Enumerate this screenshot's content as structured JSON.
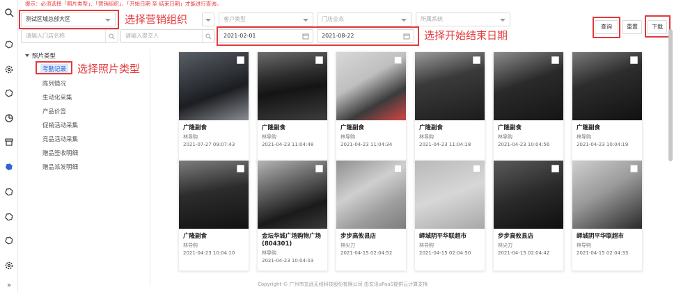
{
  "notice": "提示：必须选择「照片类型」、「营销组织」、「开始日期 至 结束日期」才能进行查询。",
  "filters": {
    "org_value": "测试区域总部大区",
    "channel_placeholder": "",
    "customer_type_placeholder": "客户类型",
    "store_type_placeholder": "门店业态",
    "system_placeholder": "所属系统",
    "store_search_placeholder": "请输入门店名称",
    "submitter_placeholder": "请输入提交人",
    "start_date": "2021-02-01",
    "end_date": "2021-08-22"
  },
  "buttons": {
    "query": "查询",
    "reset": "重置",
    "download": "下载"
  },
  "annotations": {
    "org": "选择营销组织",
    "date": "选择开始结束日期",
    "photo_type": "选择照片类型"
  },
  "tree": {
    "root": "照片类型",
    "items": [
      "考勤记录",
      "陈列情况",
      "生动化采集",
      "产品价签",
      "促销活动采集",
      "竞品活动采集",
      "赠品签收明细",
      "赠品派发明细"
    ]
  },
  "cards": [
    {
      "name": "广隆副食",
      "person": "林导购",
      "time": "2021-07-27 09:07:43"
    },
    {
      "name": "广隆副食",
      "person": "林导购",
      "time": "2021-04-23 11:04:48"
    },
    {
      "name": "广隆副食",
      "person": "林导购",
      "time": "2021-04-23 11:04:34"
    },
    {
      "name": "广隆副食",
      "person": "林导购",
      "time": "2021-04-23 11:04:18"
    },
    {
      "name": "广隆副食",
      "person": "林导购",
      "time": "2021-04-23 10:04:56"
    },
    {
      "name": "广隆副食",
      "person": "林导购",
      "time": "2021-04-23 10:04:19"
    },
    {
      "name": "广隆副食",
      "person": "林导购",
      "time": "2021-04-23 10:04:10"
    },
    {
      "name": "金坛华城广场购物广场(804301)",
      "person": "林导购",
      "time": "2021-04-23 10:04:03"
    },
    {
      "name": "步步高攸县店",
      "person": "林尖刀",
      "time": "2021-04-15 02:04:52"
    },
    {
      "name": "峄城阴平华联超市",
      "person": "林导购",
      "time": "2021-04-15 02:04:50"
    },
    {
      "name": "步步高攸县店",
      "person": "林尖刀",
      "time": "2021-04-15 02:04:42"
    },
    {
      "name": "峄城阴平华联超市",
      "person": "林导购",
      "time": "2021-04-15 02:04:33"
    }
  ],
  "footer": "Copyright © 广州市玄武无线科技股份有限公司 由玄讯aPaaS提供云计算支持",
  "colors": {
    "annotation_red": "#e4393c",
    "selected_blue": "#2f64d4"
  }
}
